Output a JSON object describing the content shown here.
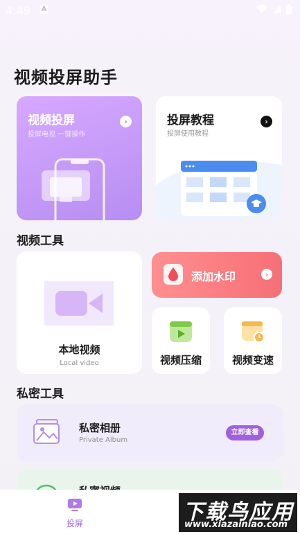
{
  "status": {
    "time": "4:49",
    "notification_glyph": "A"
  },
  "title": "视频投屏助手",
  "projection_card": {
    "title": "视频投屏",
    "subtitle": "投屏电视 一键操作"
  },
  "tutorial_card": {
    "title": "投屏教程",
    "subtitle": "投屏使用教程"
  },
  "video_tools": {
    "section_title": "视频工具",
    "local_video": {
      "title": "本地视频",
      "subtitle": "Local video"
    },
    "watermark": {
      "title": "添加水印"
    },
    "compress": {
      "title": "视频压缩"
    },
    "speed": {
      "title": "视频变速"
    }
  },
  "private_tools": {
    "section_title": "私密工具",
    "album": {
      "title": "私密相册",
      "subtitle": "Private Album",
      "button": "立即查看"
    },
    "video": {
      "title": "私密视频"
    }
  },
  "bottom_nav": {
    "tab_label": "投屏"
  },
  "watermark_logo": {
    "big_text": "下载鸟应用",
    "small_text": "www.xiazainiao.com"
  },
  "colors": {
    "accent": "#9b62e6",
    "projection_card": "#c59af7",
    "watermark_card": "#f7777f"
  },
  "icons": [
    "chevron-right-icon",
    "graduation-cap-icon",
    "video-camera-icon",
    "water-drop-icon",
    "play-icon",
    "clock-icon",
    "photo-album-icon",
    "screen-cast-icon"
  ]
}
